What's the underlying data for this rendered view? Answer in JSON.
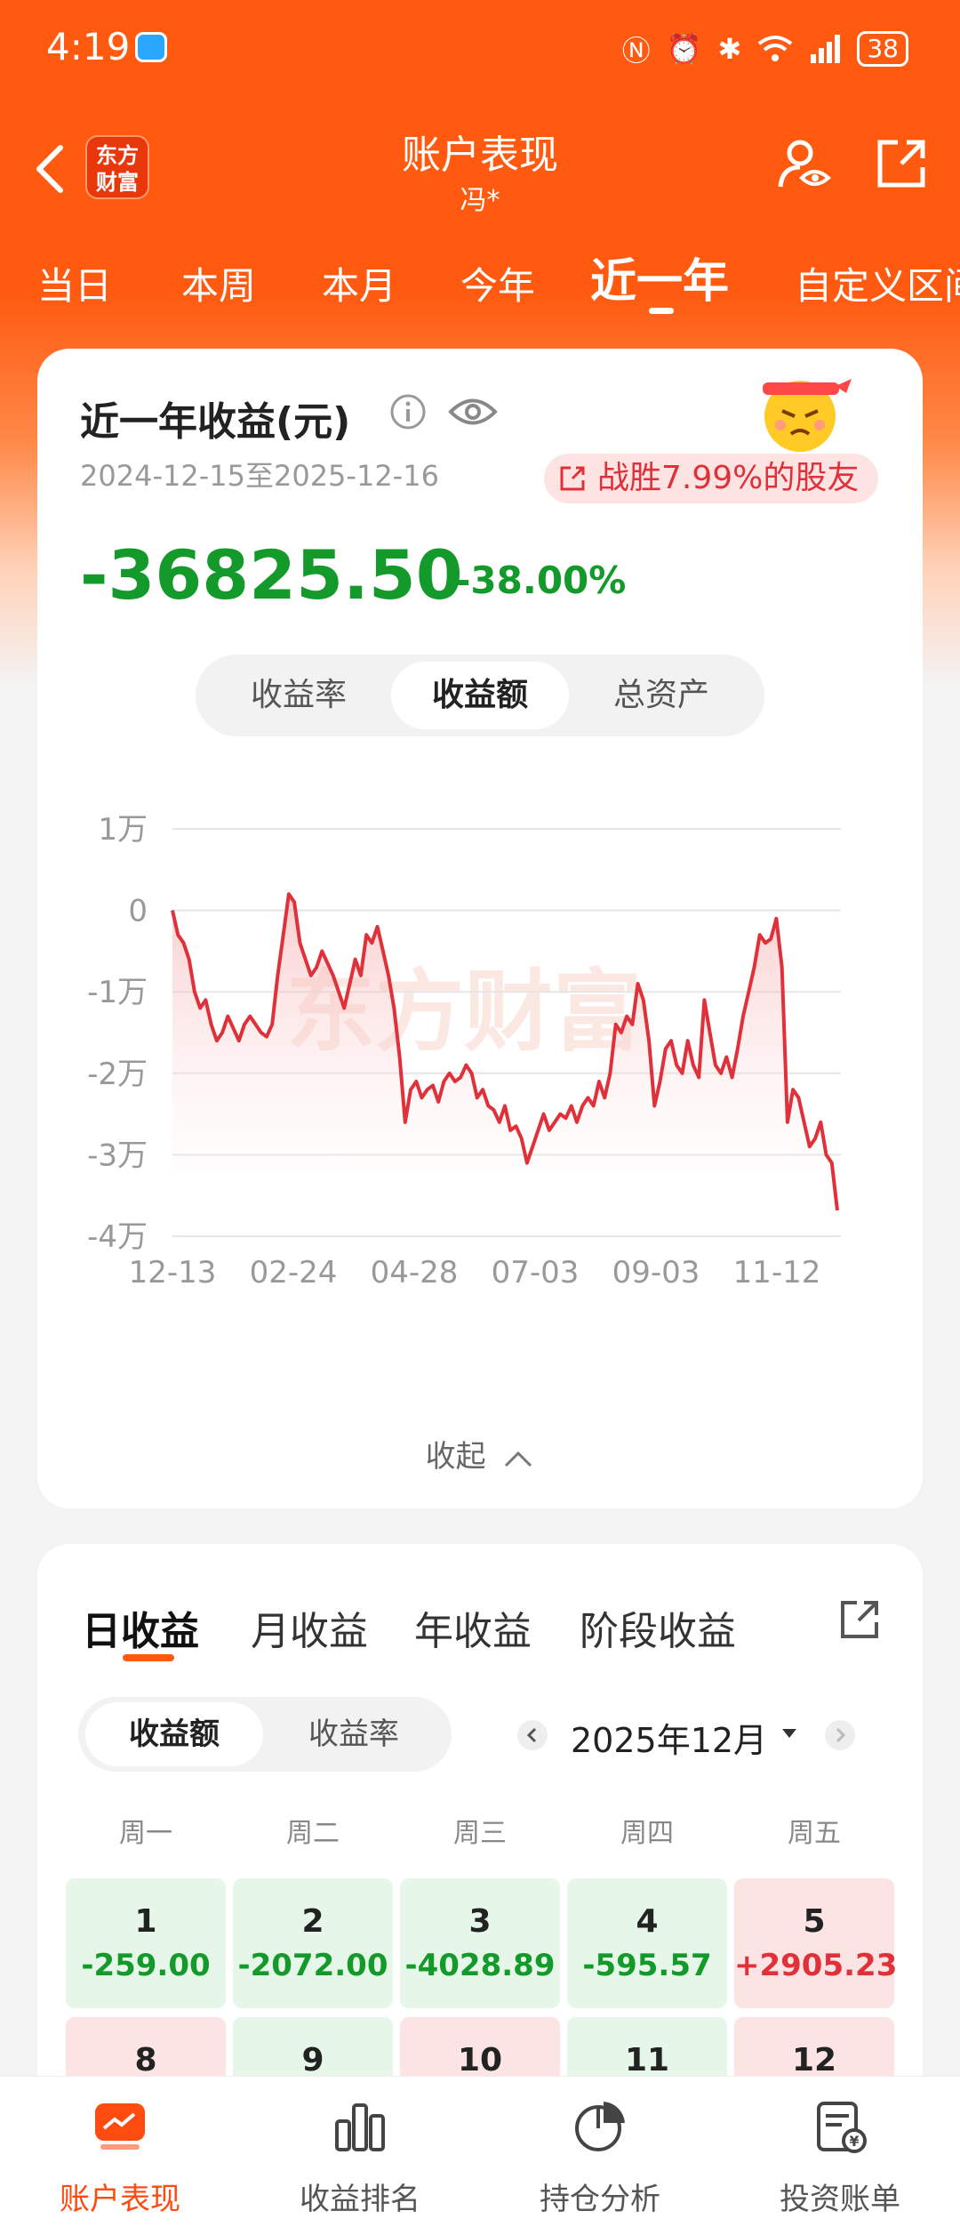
{
  "status_bar": {
    "time": "4:19",
    "battery": "38"
  },
  "nav": {
    "title": "账户表现",
    "subtitle": "冯*",
    "logo_text": "东方财富"
  },
  "period_tabs": [
    {
      "label": "当日",
      "active": false
    },
    {
      "label": "本周",
      "active": false
    },
    {
      "label": "本月",
      "active": false
    },
    {
      "label": "今年",
      "active": false
    },
    {
      "label": "近一年",
      "active": true
    },
    {
      "label": "自定义区间",
      "active": false
    }
  ],
  "summary": {
    "title": "近一年收益(元)",
    "date_range": "2024-12-15至2025-12-16",
    "beat_text": "战胜7.99%的股友",
    "amount": "-36825.50",
    "percent": "-38.00%",
    "segments": [
      "收益率",
      "收益额",
      "总资产"
    ],
    "active_segment": "收益额",
    "collapse_label": "收起"
  },
  "colors": {
    "brand": "#ff5a10",
    "loss": "#139a2a",
    "gain": "#e0303a",
    "line": "#e0303a"
  },
  "chart_data": {
    "type": "line",
    "watermark": "东方财富",
    "ylim": [
      -40000,
      10000
    ],
    "y_ticks": [
      10000,
      0,
      -10000,
      -20000,
      -30000,
      -40000
    ],
    "y_tick_labels": [
      "1万",
      "0",
      "-1万",
      "-2万",
      "-3万",
      "-4万"
    ],
    "x_tick_labels": [
      "12-13",
      "02-24",
      "04-28",
      "07-03",
      "09-03",
      "11-12"
    ],
    "series": [
      {
        "values": [
          0,
          -3000,
          -4000,
          -6000,
          -10000,
          -12000,
          -11000,
          -14000,
          -16000,
          -15000,
          -13000,
          -14500,
          -16000,
          -14000,
          -13000,
          -14000,
          -15000,
          -15500,
          -14000,
          -8000,
          -3000,
          2000,
          1000,
          -4000,
          -6000,
          -8000,
          -7000,
          -5000,
          -6500,
          -8000,
          -10000,
          -12000,
          -9000,
          -6000,
          -8000,
          -3000,
          -4000,
          -2000,
          -5000,
          -8000,
          -12000,
          -18000,
          -26000,
          -22000,
          -21000,
          -23000,
          -22000,
          -21500,
          -23500,
          -21000,
          -20000,
          -21000,
          -20500,
          -19000,
          -20000,
          -23000,
          -22000,
          -24000,
          -24500,
          -26000,
          -24000,
          -27000,
          -26500,
          -28000,
          -31000,
          -29000,
          -27000,
          -25000,
          -27000,
          -26000,
          -25000,
          -25500,
          -24000,
          -26000,
          -24000,
          -23000,
          -24000,
          -21000,
          -23000,
          -20000,
          -14000,
          -15000,
          -13000,
          -14000,
          -9000,
          -11000,
          -16000,
          -24000,
          -21000,
          -17000,
          -16000,
          -19000,
          -20000,
          -16000,
          -19000,
          -20500,
          -11000,
          -15000,
          -19000,
          -20000,
          -18000,
          -20500,
          -17000,
          -13000,
          -10000,
          -7000,
          -3000,
          -4000,
          -3500,
          -1000,
          -7000,
          -26000,
          -22000,
          -23000,
          -26000,
          -29000,
          -28000,
          -26000,
          -30000,
          -31000,
          -36825
        ]
      }
    ],
    "grid": true
  },
  "daily": {
    "tabs": [
      "日收益",
      "月收益",
      "年收益",
      "阶段收益"
    ],
    "active_tab": "日收益",
    "segments": [
      "收益额",
      "收益率"
    ],
    "active_segment": "收益额",
    "month": "2025年12月",
    "weekdays": [
      "周一",
      "周二",
      "周三",
      "周四",
      "周五"
    ],
    "days": [
      {
        "day": "1",
        "value": "-259.00",
        "tone": "green"
      },
      {
        "day": "2",
        "value": "-2072.00",
        "tone": "green"
      },
      {
        "day": "3",
        "value": "-4028.89",
        "tone": "green"
      },
      {
        "day": "4",
        "value": "-595.57",
        "tone": "green"
      },
      {
        "day": "5",
        "value": "+2905.23",
        "tone": "red"
      },
      {
        "day": "8",
        "value": "",
        "tone": "red"
      },
      {
        "day": "9",
        "value": "",
        "tone": "green"
      },
      {
        "day": "10",
        "value": "",
        "tone": "red"
      },
      {
        "day": "11",
        "value": "",
        "tone": "green"
      },
      {
        "day": "12",
        "value": "",
        "tone": "red"
      }
    ]
  },
  "bottom_nav": [
    {
      "label": "账户表现",
      "icon": "chart-screen-icon",
      "active": true
    },
    {
      "label": "收益排名",
      "icon": "bar-ranking-icon",
      "active": false
    },
    {
      "label": "持仓分析",
      "icon": "pie-chart-icon",
      "active": false
    },
    {
      "label": "投资账单",
      "icon": "bill-icon",
      "active": false
    }
  ]
}
